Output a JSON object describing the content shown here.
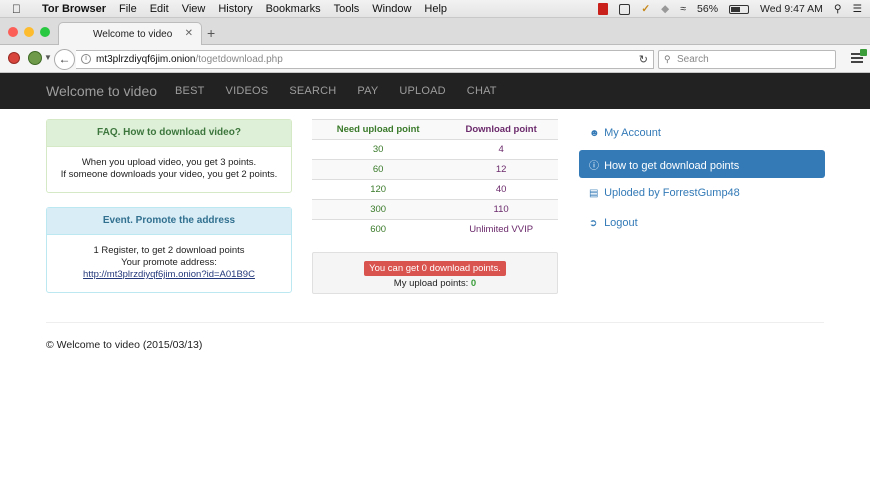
{
  "menubar": {
    "app": "Tor Browser",
    "items": [
      "File",
      "Edit",
      "View",
      "History",
      "Bookmarks",
      "Tools",
      "Window",
      "Help"
    ],
    "battery": "56%",
    "clock": "Wed 9:47 AM"
  },
  "browser": {
    "tab_title": "Welcome to video",
    "url_host": "mt3plrzdiyqf6jim.onion",
    "url_path": "/togetdownload.php",
    "search_placeholder": "Search"
  },
  "site": {
    "brand": "Welcome to video",
    "nav": [
      "BEST",
      "VIDEOS",
      "SEARCH",
      "PAY",
      "UPLOAD",
      "CHAT"
    ]
  },
  "faq": {
    "title": "FAQ. How to download video?",
    "line1": "When you upload video, you get 3 points.",
    "line2": "If someone downloads your video, you get 2 points."
  },
  "event": {
    "title": "Event. Promote the address",
    "line1": "1 Register, to get 2 download points",
    "line2": "Your promote address:",
    "link": "http://mt3plrzdiyqf6jim.onion?id=A01B9C"
  },
  "points_table": {
    "headers": [
      "Need upload point",
      "Download point"
    ],
    "rows": [
      [
        "30",
        "4"
      ],
      [
        "60",
        "12"
      ],
      [
        "120",
        "40"
      ],
      [
        "300",
        "110"
      ],
      [
        "600",
        "Unlimited VVIP"
      ]
    ]
  },
  "status": {
    "badge": "You can get 0 download points.",
    "upload_label": "My upload points:",
    "upload_value": "0"
  },
  "sidebar": {
    "items": [
      {
        "label": "My Account",
        "icon": "user-icon"
      },
      {
        "label": "How to get download points",
        "icon": "info-circle-icon"
      },
      {
        "label": "Uploded by ForrestGump48",
        "icon": "list-icon"
      },
      {
        "label": "Logout",
        "icon": "logout-icon"
      }
    ]
  },
  "footer": "© Welcome to video (2015/03/13)"
}
